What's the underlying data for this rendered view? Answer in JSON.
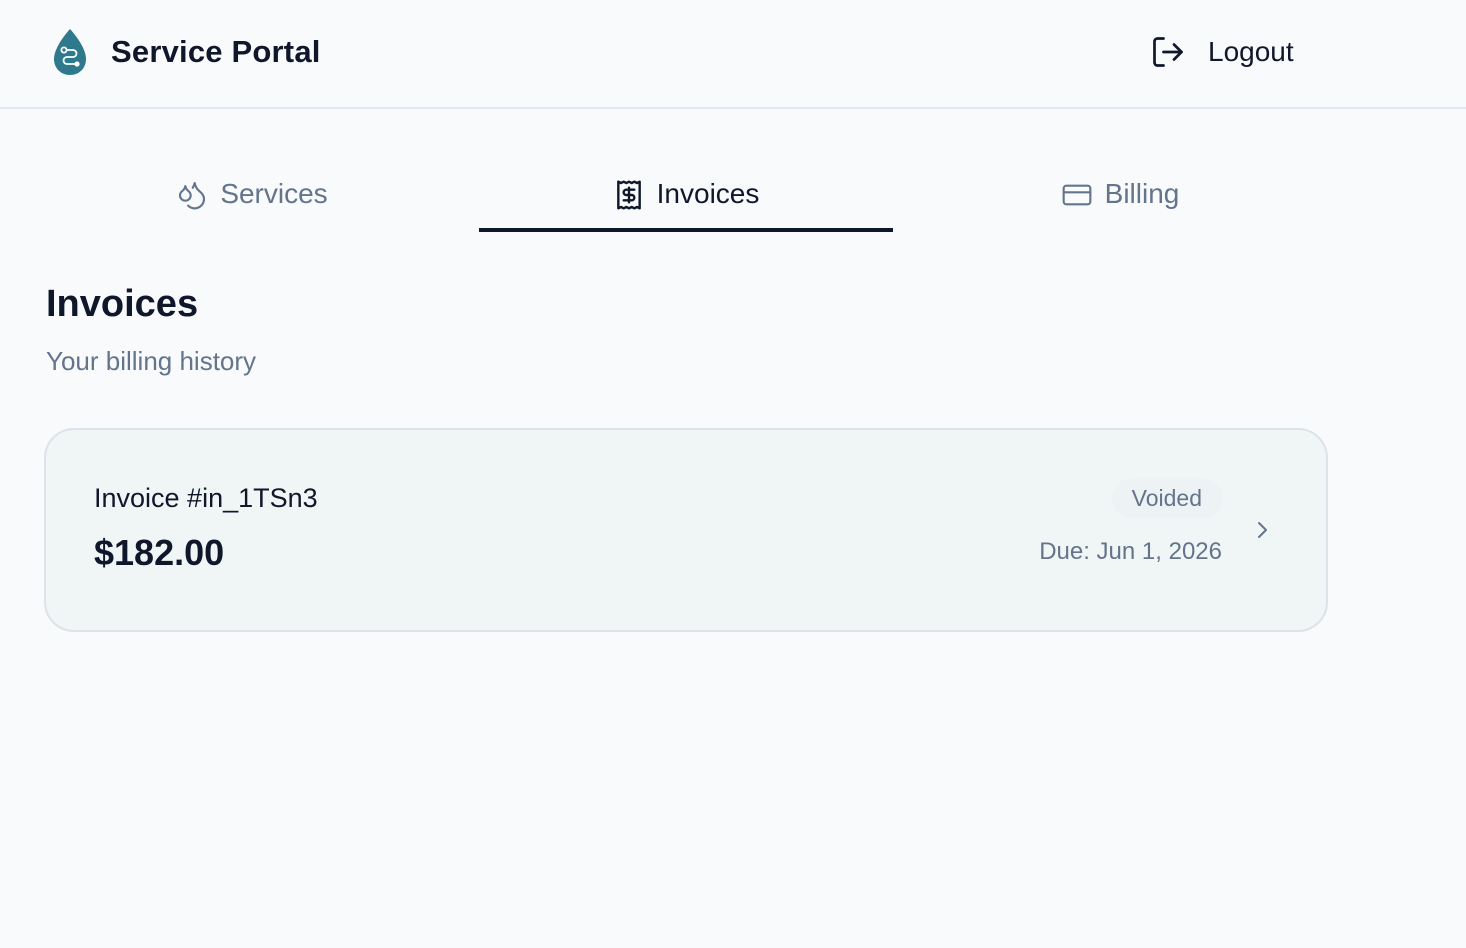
{
  "header": {
    "brand_title": "Service Portal",
    "brand_logo_icon": "water-drop-route-icon",
    "logout_label": "Logout",
    "logout_icon": "logout-icon"
  },
  "tabs": [
    {
      "label": "Services",
      "icon": "droplets-icon",
      "active": false
    },
    {
      "label": "Invoices",
      "icon": "receipt-icon",
      "active": true
    },
    {
      "label": "Billing",
      "icon": "credit-card-icon",
      "active": false
    }
  ],
  "main": {
    "title": "Invoices",
    "subtitle": "Your billing history"
  },
  "invoices": [
    {
      "number": "Invoice #in_1TSn3",
      "amount": "$182.00",
      "status": "Voided",
      "due": "Due: Jun 1, 2026"
    }
  ],
  "colors": {
    "primary_text": "#0f172a",
    "muted_text": "#64748b",
    "brand_teal": "#2e7a8c",
    "background": "#f8fafc",
    "card_background": "#f0f5f6"
  }
}
